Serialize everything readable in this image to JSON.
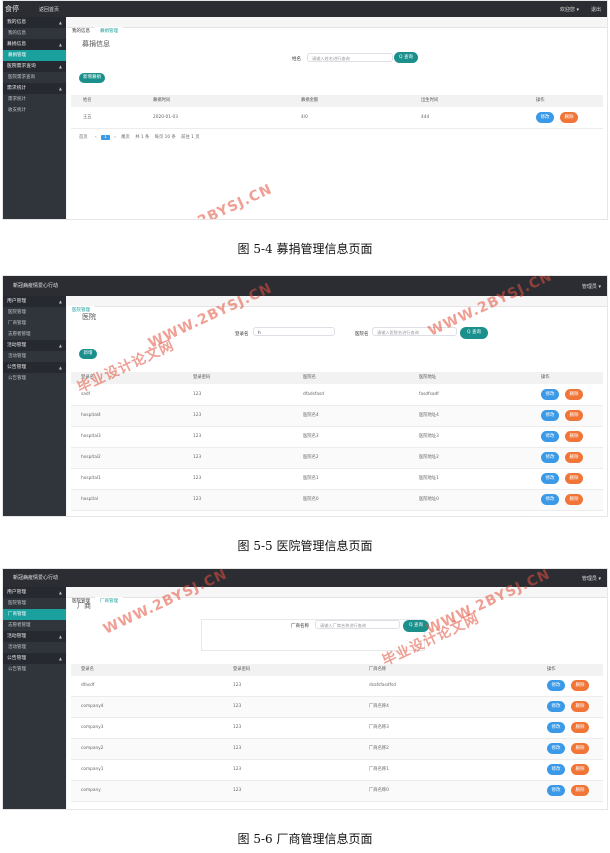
{
  "fig1": {
    "top_title": "食停",
    "top_nav": "返回首页",
    "top_user": "欢迎您 ▾",
    "top_exit": "退出",
    "sidebar": [
      {
        "type": "group",
        "label": "我的信息"
      },
      {
        "type": "item",
        "label": "我的信息"
      },
      {
        "type": "group",
        "label": "募捐信息"
      },
      {
        "type": "item",
        "label": "募捐管理",
        "active": true
      },
      {
        "type": "group",
        "label": "医院需求查询"
      },
      {
        "type": "item",
        "label": "医院需求查询"
      },
      {
        "type": "group",
        "label": "需求统计"
      },
      {
        "type": "item",
        "label": "需求统计"
      },
      {
        "type": "item",
        "label": "收支统计"
      }
    ],
    "tabs": [
      "我的信息",
      "募捐管理"
    ],
    "section_title": "募捐信息",
    "search_label": "姓名",
    "search_placeholder": "请输入姓名进行查询",
    "search_button": "Q 查询",
    "add_button": "新增募捐",
    "headers": [
      "姓名",
      "募捐时间",
      "募捐金额",
      "出生时间",
      "操作"
    ],
    "rows": [
      [
        "王五",
        "2020-01-03",
        "4/0",
        "444"
      ]
    ],
    "pagination": {
      "total_text": "共 1 条",
      "per_page": "每页 10 条",
      "jump": "前往 1 页",
      "first": "首页",
      "last": "尾页",
      "page": "1"
    },
    "edit_label": "修改",
    "delete_label": "删除",
    "caption": "图 5-4 募捐管理信息页面"
  },
  "fig2": {
    "top_title": "新冠病疫情爱心行动",
    "top_user": "管理员 ▾",
    "sidebar": [
      {
        "type": "group",
        "label": "用户管理"
      },
      {
        "type": "item",
        "label": "医院管理"
      },
      {
        "type": "item",
        "label": "厂商管理"
      },
      {
        "type": "item",
        "label": "志愿者管理"
      },
      {
        "type": "group",
        "label": "活动管理"
      },
      {
        "type": "item",
        "label": "活动管理"
      },
      {
        "type": "group",
        "label": "公告管理"
      },
      {
        "type": "item",
        "label": "公告管理"
      }
    ],
    "tabs": [
      "医院管理"
    ],
    "section_title": "医院",
    "search1_label": "登录名",
    "search1_value": "h",
    "search2_label": "医院名",
    "search2_placeholder": "请输入医院名进行查询",
    "search_button": "Q 查询",
    "add_button": "新增",
    "headers": [
      "登录名",
      "登录密码",
      "医院名",
      "医院地址",
      "操作"
    ],
    "rows": [
      [
        "sadf",
        "123",
        "dfadsfasd",
        "fasdfsadf"
      ],
      [
        "hospital4",
        "123",
        "医院名4",
        "医院地址4"
      ],
      [
        "hospital3",
        "123",
        "医院名3",
        "医院地址3"
      ],
      [
        "hospital2",
        "123",
        "医院名2",
        "医院地址2"
      ],
      [
        "hospital1",
        "123",
        "医院名1",
        "医院地址1"
      ],
      [
        "hospital",
        "123",
        "医院名0",
        "医院地址0"
      ]
    ],
    "edit_label": "修改",
    "delete_label": "删除",
    "caption": "图 5-5 医院管理信息页面"
  },
  "fig3": {
    "top_title": "新冠病疫情爱心行动",
    "top_user": "管理员 ▾",
    "sidebar": [
      {
        "type": "group",
        "label": "用户管理"
      },
      {
        "type": "item",
        "label": "医院管理"
      },
      {
        "type": "item",
        "label": "厂商管理",
        "active": true
      },
      {
        "type": "item",
        "label": "志愿者管理"
      },
      {
        "type": "group",
        "label": "活动管理"
      },
      {
        "type": "item",
        "label": "活动管理"
      },
      {
        "type": "group",
        "label": "公告管理"
      },
      {
        "type": "item",
        "label": "公告管理"
      }
    ],
    "tabs": [
      "医院管理",
      "厂商管理"
    ],
    "section_title": "厂商",
    "search_label": "厂商名称",
    "search_placeholder": "请输入厂商名称进行查询",
    "search_button": "Q 查询",
    "headers": [
      "登录名",
      "登录密码",
      "厂商名称",
      "操作"
    ],
    "rows": [
      [
        "dfasdf",
        "123",
        "dsafsfasdfsd"
      ],
      [
        "company4",
        "123",
        "厂商名称4"
      ],
      [
        "company3",
        "123",
        "厂商名称3"
      ],
      [
        "company2",
        "123",
        "厂商名称2"
      ],
      [
        "company1",
        "123",
        "厂商名称1"
      ],
      [
        "company",
        "123",
        "厂商名称0"
      ]
    ],
    "edit_label": "修改",
    "delete_label": "删除",
    "caption": "图 5-6 厂商管理信息页面"
  },
  "watermark": {
    "site": "WWW.2BYSJ.CN",
    "name": "毕业设计论文网"
  }
}
